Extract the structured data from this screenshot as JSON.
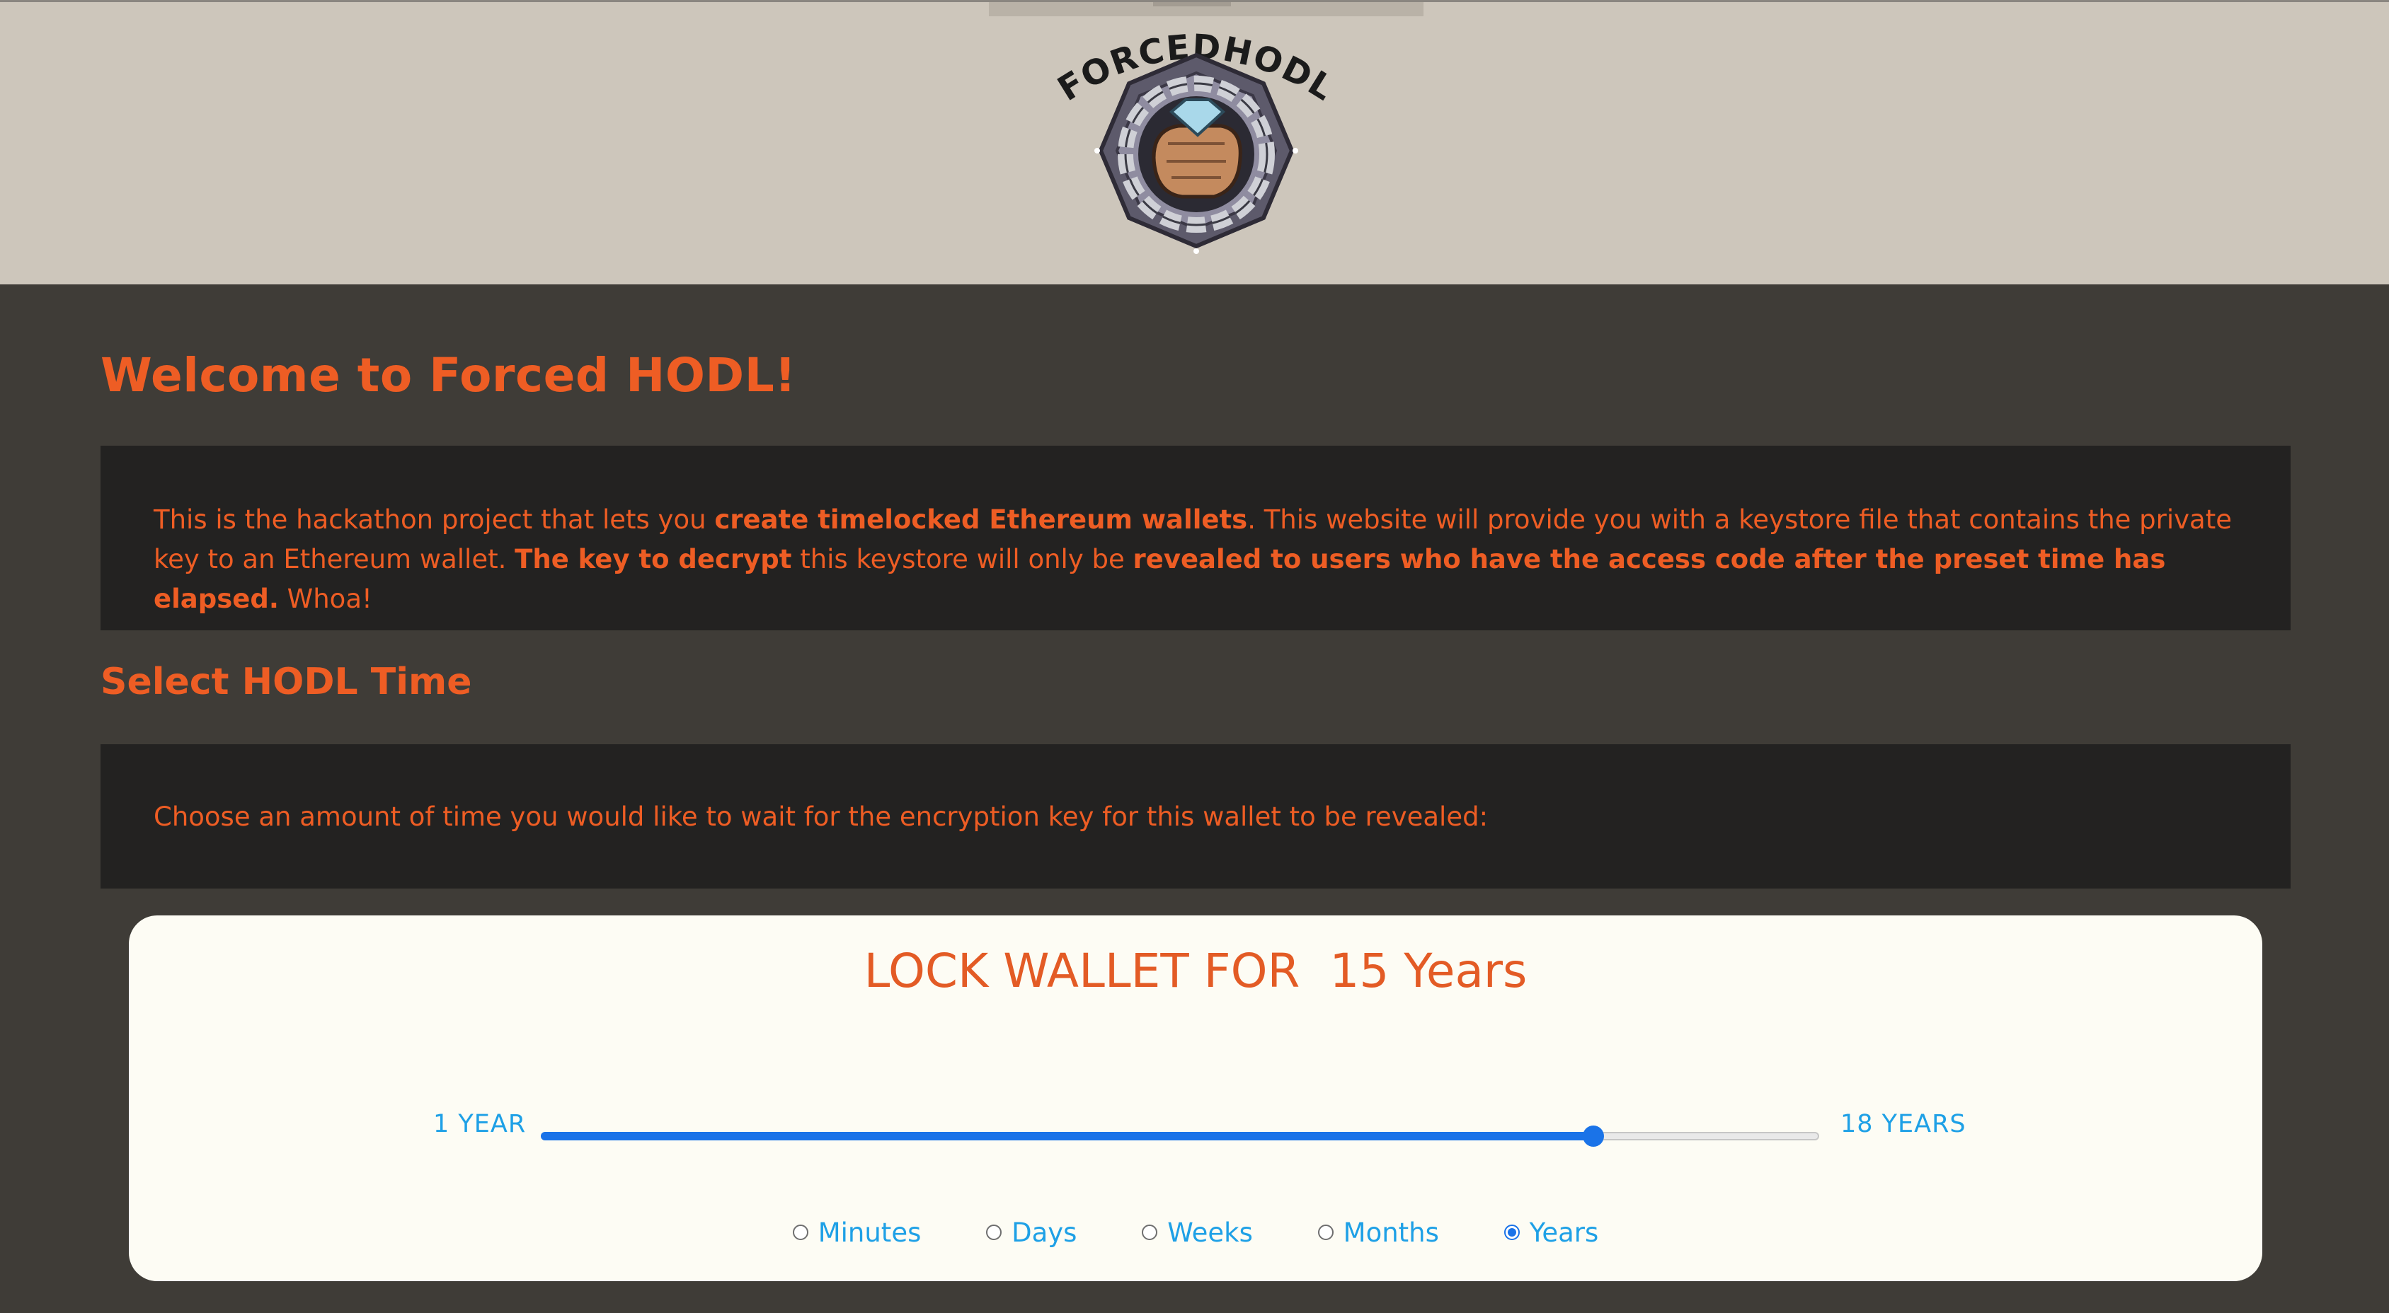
{
  "header": {
    "logo_text": "FORCEDHODL"
  },
  "main": {
    "title": "Welcome to Forced HODL!",
    "intro": {
      "t1": "This is the hackathon project that lets you ",
      "b1": "create timelocked Ethereum wallets",
      "t2": ". This website will provide you with a keystore file that contains the private key to an Ethereum wallet. ",
      "b2": "The key to decrypt",
      "t3": " this keystore will only be ",
      "b3": "revealed to users who have the access code after the preset time has elapsed.",
      "t4": " Whoa!"
    },
    "subtitle": "Select HODL Time",
    "choose_text": "Choose an amount of time you would like to wait for the encryption key for this wallet to be revealed:"
  },
  "lock": {
    "heading": "LOCK WALLET FOR  15 Years",
    "range_min_label": "1 YEAR",
    "range_max_label": "18 YEARS",
    "slider": {
      "min": 1,
      "max": 18,
      "value": 15
    },
    "units": [
      {
        "label": "Minutes",
        "checked": false
      },
      {
        "label": "Days",
        "checked": false
      },
      {
        "label": "Weeks",
        "checked": false
      },
      {
        "label": "Months",
        "checked": false
      },
      {
        "label": "Years",
        "checked": true
      }
    ]
  },
  "colors": {
    "accent": "#ee5d24",
    "link_blue": "#1ea0e6",
    "slider_blue": "#1a73e8",
    "header_bg": "#cdc6bb",
    "page_bg": "#3f3c37",
    "panel_bg": "#232221",
    "card_bg": "#fdfcf4"
  },
  "icons": {
    "logo": "forcedhodl-logo-fist-diamond-chain"
  }
}
